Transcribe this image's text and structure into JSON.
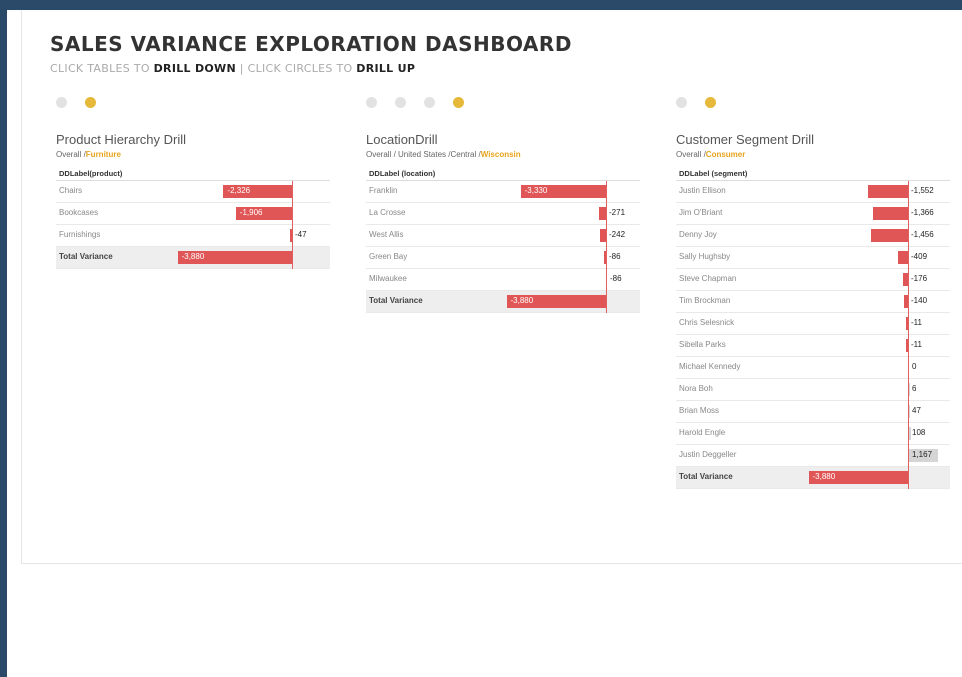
{
  "header": {
    "title": "SALES VARIANCE EXPLORATION DASHBOARD",
    "subtitle_pre": "CLICK TABLES TO ",
    "subtitle_drill_down": "DRILL DOWN",
    "subtitle_mid": " | CLICK CIRCLES TO ",
    "subtitle_drill_up": "DRILL UP"
  },
  "colors": {
    "negative": "#e05656",
    "positive": "#d5d5d5",
    "active_dot": "#e7b93b",
    "inactive_dot": "#e2e2e2"
  },
  "panels": [
    {
      "id": "product",
      "title": "Product Hierarchy Drill",
      "crumb_prefix": "Overall /",
      "crumb_current": "Furniture",
      "column_header": "DDLabel(product)",
      "dots": [
        false,
        true
      ],
      "scale_max": 3900,
      "rows": [
        {
          "label": "Chairs",
          "value": -2326,
          "display": "-2,326"
        },
        {
          "label": "Bookcases",
          "value": -1906,
          "display": "-1,906"
        },
        {
          "label": "Furnishings",
          "value": -47,
          "display": "-47"
        }
      ],
      "total": {
        "label": "Total Variance",
        "value": -3880,
        "display": "-3,880"
      }
    },
    {
      "id": "location",
      "title": "LocationDrill",
      "crumb_prefix": "Overall / United States /Central /",
      "crumb_current": "Wisconsin",
      "column_header": "DDLabel (location)",
      "dots": [
        false,
        false,
        false,
        true
      ],
      "scale_max": 3900,
      "rows": [
        {
          "label": "Franklin",
          "value": -3330,
          "display": "-3,330"
        },
        {
          "label": "La Crosse",
          "value": -271,
          "display": "-271"
        },
        {
          "label": "West Allis",
          "value": -242,
          "display": "-242"
        },
        {
          "label": "Green Bay",
          "value": -86,
          "display": "-86"
        },
        {
          "label": "Milwaukee",
          "value": 0,
          "display": "-86"
        }
      ],
      "total": {
        "label": "Total Variance",
        "value": -3880,
        "display": "-3,880"
      }
    },
    {
      "id": "customer",
      "title": "Customer Segment Drill",
      "crumb_prefix": "Overall /",
      "crumb_current": "Consumer",
      "column_header": "DDLabel (segment)",
      "dots": [
        false,
        true
      ],
      "scale_max": 3900,
      "rows": [
        {
          "label": "Justin Ellison",
          "value": -1552,
          "display": "-1,552"
        },
        {
          "label": "Jim O'Briant",
          "value": -1366,
          "display": "-1,366"
        },
        {
          "label": "Denny Joy",
          "value": -1456,
          "display": "-1,456"
        },
        {
          "label": "Sally Hughsby",
          "value": -409,
          "display": "-409"
        },
        {
          "label": "Steve Chapman",
          "value": -176,
          "display": "-176"
        },
        {
          "label": "Tim Brockman",
          "value": -140,
          "display": "-140"
        },
        {
          "label": "Chris Selesnick",
          "value": -11,
          "display": "-11"
        },
        {
          "label": "Sibella Parks",
          "value": -11,
          "display": "-11"
        },
        {
          "label": "Michael Kennedy",
          "value": 0,
          "display": "0"
        },
        {
          "label": "Nora Boh",
          "value": 6,
          "display": "6"
        },
        {
          "label": "Brian Moss",
          "value": 47,
          "display": "47"
        },
        {
          "label": "Harold Engle",
          "value": 108,
          "display": "108"
        },
        {
          "label": "Justin Deggeller",
          "value": 1167,
          "display": "1,167"
        }
      ],
      "total": {
        "label": "Total Variance",
        "value": -3880,
        "display": "-3,880"
      }
    }
  ]
}
